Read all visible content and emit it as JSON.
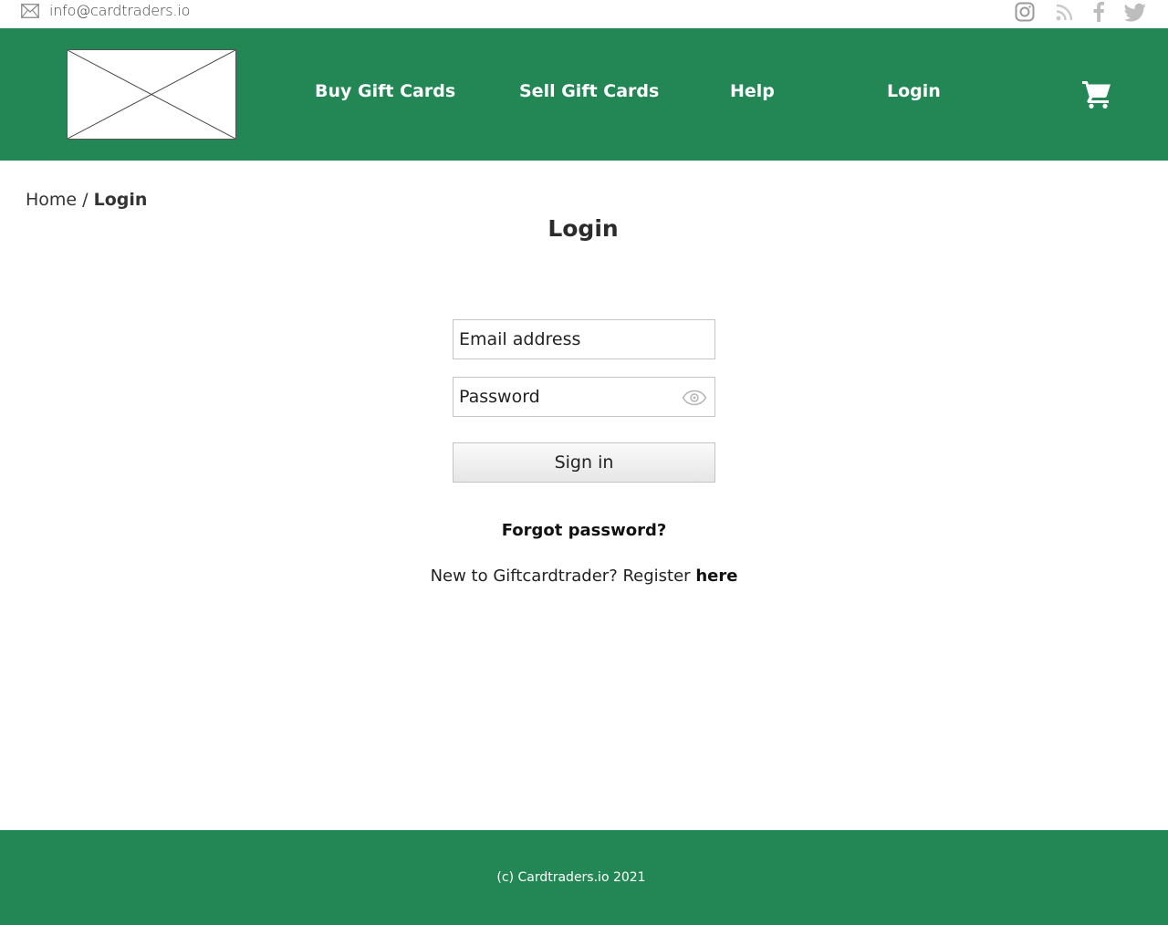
{
  "topbar": {
    "email": "info@cardtraders.io",
    "icons": [
      "mail-icon",
      "instagram-icon",
      "rss-icon",
      "facebook-icon",
      "twitter-icon"
    ]
  },
  "header": {
    "logo": "logo-placeholder",
    "nav": {
      "buy": "Buy Gift Cards",
      "sell": "Sell Gift Cards",
      "help": "Help",
      "login": "Login"
    },
    "cart_icon": "cart-icon"
  },
  "breadcrumb": {
    "home": "Home",
    "separator": "/",
    "current": "Login"
  },
  "page": {
    "title": "Login"
  },
  "form": {
    "email_placeholder": "Email address",
    "email_value": "",
    "password_placeholder": "Password",
    "password_value": "",
    "signin_label": "Sign in",
    "eye_icon": "eye-icon"
  },
  "links": {
    "forgot": "Forgot password?",
    "register_prefix": "New to Giftcardtrader? Register",
    "register_link": "here"
  },
  "footer": {
    "copyright": "(c) Cardtraders.io 2021"
  },
  "colors": {
    "brand_green": "#238655",
    "header_text": "#ffffff",
    "input_border": "#c4c4c4"
  }
}
